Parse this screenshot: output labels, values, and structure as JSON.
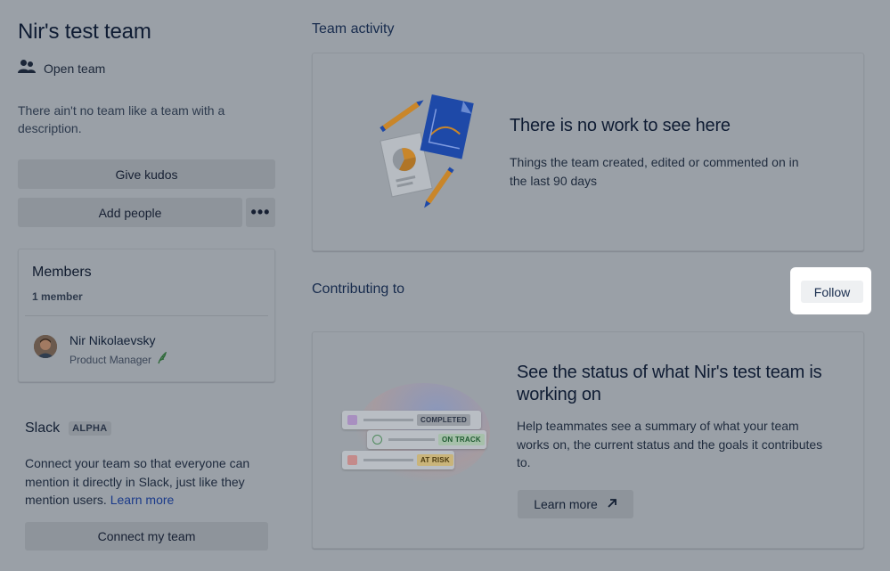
{
  "sidebar": {
    "team_name": "Nir's test team",
    "team_type": "Open team",
    "description": "There ain't no team like a team with a description.",
    "give_kudos_label": "Give kudos",
    "add_people_label": "Add people",
    "more_label": "•••",
    "members": {
      "title": "Members",
      "count": "1 member",
      "list": [
        {
          "name": "Nir Nikolaevsky",
          "role": "Product Manager"
        }
      ]
    },
    "slack": {
      "title": "Slack",
      "badge": "ALPHA",
      "text": "Connect your team so that everyone can mention it directly in Slack, just like they mention users.",
      "link": "Learn more",
      "connect_label": "Connect my team"
    }
  },
  "main": {
    "activity": {
      "title": "Team activity",
      "empty_heading": "There is no work to see here",
      "empty_sub": "Things the team created, edited or commented on in the last 90 days"
    },
    "contributing": {
      "title": "Contributing to",
      "follow_label": "Follow",
      "heading": "See the status of what Nir's test team is working on",
      "sub": "Help teammates see a summary of what your team works on, the current status and the goals it contributes to.",
      "learn_more_label": "Learn more",
      "statuses": [
        "COMPLETED",
        "ON TRACK",
        "AT RISK"
      ]
    }
  },
  "colors": {
    "overlay": "#9aa0a7",
    "highlight": "#ffffff",
    "accent_blue": "#1d4fd8",
    "accent_orange": "#f59e0b"
  }
}
